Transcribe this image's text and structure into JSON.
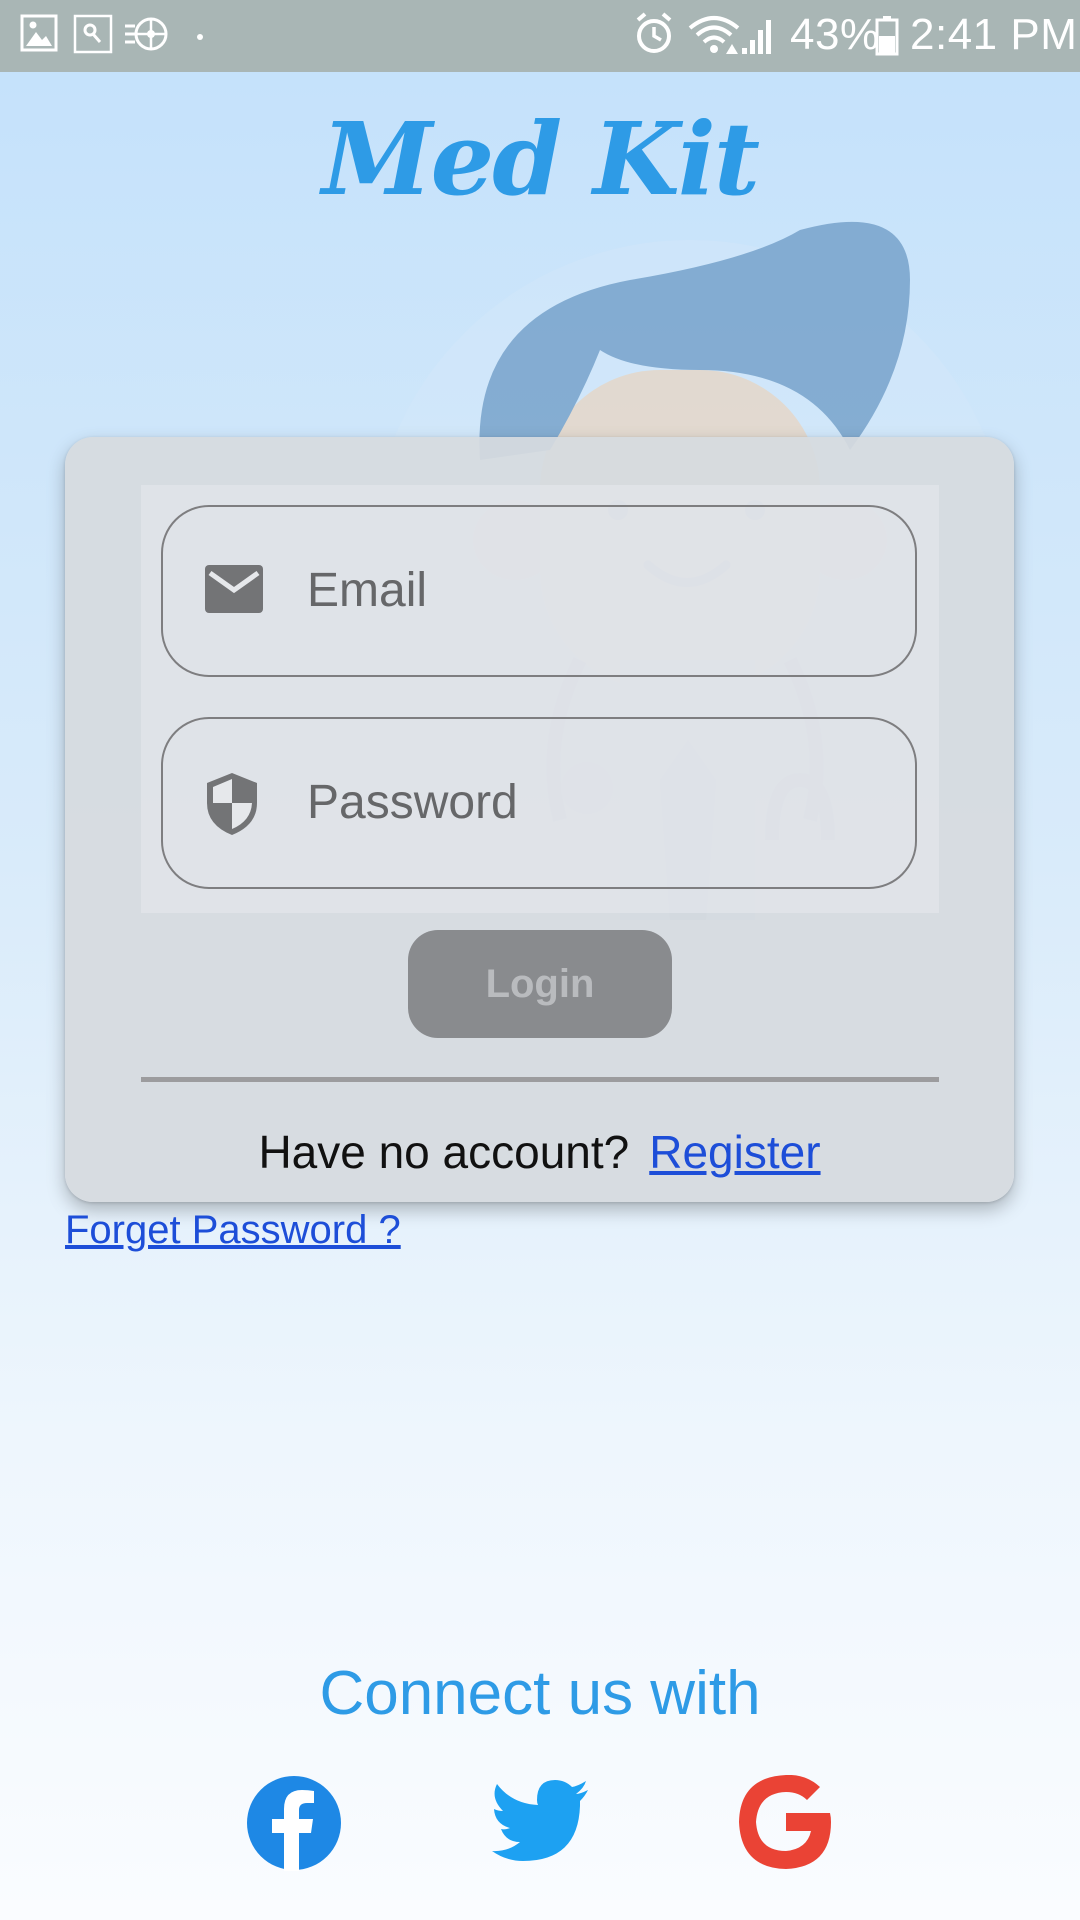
{
  "status_bar": {
    "battery_percent": "43%",
    "time": "2:41 PM",
    "icons": [
      "image-icon",
      "key-icon",
      "hub-icon",
      "dot-icon",
      "alarm-icon",
      "wifi-icon",
      "signal-icon",
      "battery-icon"
    ]
  },
  "app": {
    "title": "Med Kit"
  },
  "login_form": {
    "email_placeholder": "Email",
    "password_placeholder": "Password",
    "login_label": "Login",
    "no_account_text": "Have no account?",
    "register_label": "Register"
  },
  "forget_password_label": "Forget Password ?",
  "connect": {
    "heading": "Connect us with",
    "icons": [
      "facebook-icon",
      "twitter-icon",
      "google-icon"
    ]
  },
  "colors": {
    "accent": "#2e9be6",
    "link": "#1d4ed8",
    "facebook": "#1e88e5",
    "twitter": "#1da1f2",
    "google": "#ea4335"
  }
}
